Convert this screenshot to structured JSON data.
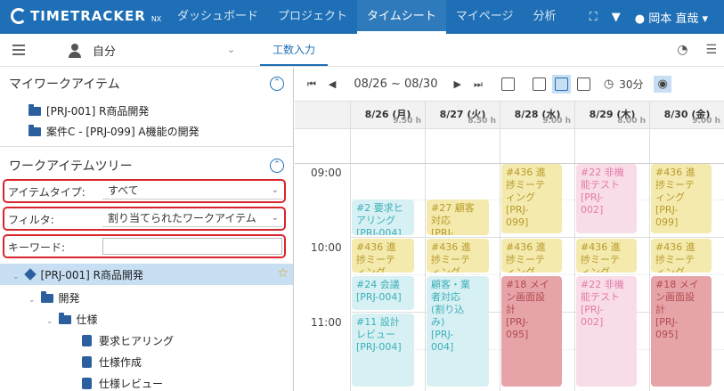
{
  "app": {
    "logo": "TIMETRACKER",
    "logo_sub": "NX"
  },
  "nav": [
    {
      "label": "ダッシュボード",
      "active": false
    },
    {
      "label": "プロジェクト",
      "active": false
    },
    {
      "label": "タイムシート",
      "active": true
    },
    {
      "label": "マイページ",
      "active": false
    },
    {
      "label": "分析",
      "active": false
    }
  ],
  "top_icons": {
    "fullscreen": "⛶",
    "bell": "🔔",
    "user_name": "岡本 直哉"
  },
  "subbar": {
    "user": "自分",
    "tab": "工数入力"
  },
  "left": {
    "my_items_title": "マイワークアイテム",
    "my_items": [
      "[PRJ-001] R商品開発",
      "案件C - [PRJ-099] A機能の開発"
    ],
    "tree_title": "ワークアイテムツリー",
    "filter_type_label": "アイテムタイプ:",
    "filter_type_value": "すべて",
    "filter_label": "フィルタ:",
    "filter_value": "割り当てられたワークアイテム",
    "keyword_label": "キーワード:",
    "tree": [
      {
        "label": "[PRJ-001] R商品開発",
        "level": 0
      },
      {
        "label": "開発",
        "level": 1
      },
      {
        "label": "仕様",
        "level": 2
      },
      {
        "label": "要求ヒアリング",
        "level": 3
      },
      {
        "label": "仕様作成",
        "level": 3
      },
      {
        "label": "仕様レビュー",
        "level": 3
      }
    ]
  },
  "calendar": {
    "range": "08/26 ~ 08/30",
    "unit": "30分",
    "days": [
      {
        "title": "8/26 (月)",
        "hours": "9.50 h"
      },
      {
        "title": "8/27 (火)",
        "hours": "8.50 h"
      },
      {
        "title": "8/28 (水)",
        "hours": "9.00 h"
      },
      {
        "title": "8/29 (木)",
        "hours": "8.00 h"
      },
      {
        "title": "8/30 (金)",
        "hours": "9.00 h"
      }
    ],
    "times": [
      "09:00",
      "10:00",
      "11:00"
    ],
    "events": [
      {
        "text": "#436 進\n捗ミーテ\nィング\n[PRJ-\n099]"
      },
      {
        "text": "#22 非機\n能テスト\n[PRJ-\n002]"
      },
      {
        "text": "#436 進\n捗ミーテ\nィング\n[PRJ-\n099]"
      },
      {
        "text": "#2 要求ヒ\nアリング\n[PRJ-004]"
      },
      {
        "text": "#27 顧客\n対応\n[PRJ-"
      },
      {
        "text": "#436 進\n捗ミーテ\nィング"
      },
      {
        "text": "#436 進\n捗ミーテ\nィング"
      },
      {
        "text": "#436 進\n捗ミーテ\nィング"
      },
      {
        "text": "#436 進\n捗ミーテ\nィング"
      },
      {
        "text": "#436 進\n捗ミーテ\nィング"
      },
      {
        "text": "#24 会議\n[PRJ-004]"
      },
      {
        "text": "顧客・業\n者対応\n(割り込\nみ)\n[PRJ-\n004]"
      },
      {
        "text": "#18 メイ\nン画面設\n計\n[PRJ-\n095]"
      },
      {
        "text": "#22 非機\n能テスト\n[PRJ-\n002]"
      },
      {
        "text": "#18 メイ\nン画面設\n計\n[PRJ-\n095]"
      },
      {
        "text": "#11 設計\nレビュー\n[PRJ-004]"
      }
    ]
  }
}
